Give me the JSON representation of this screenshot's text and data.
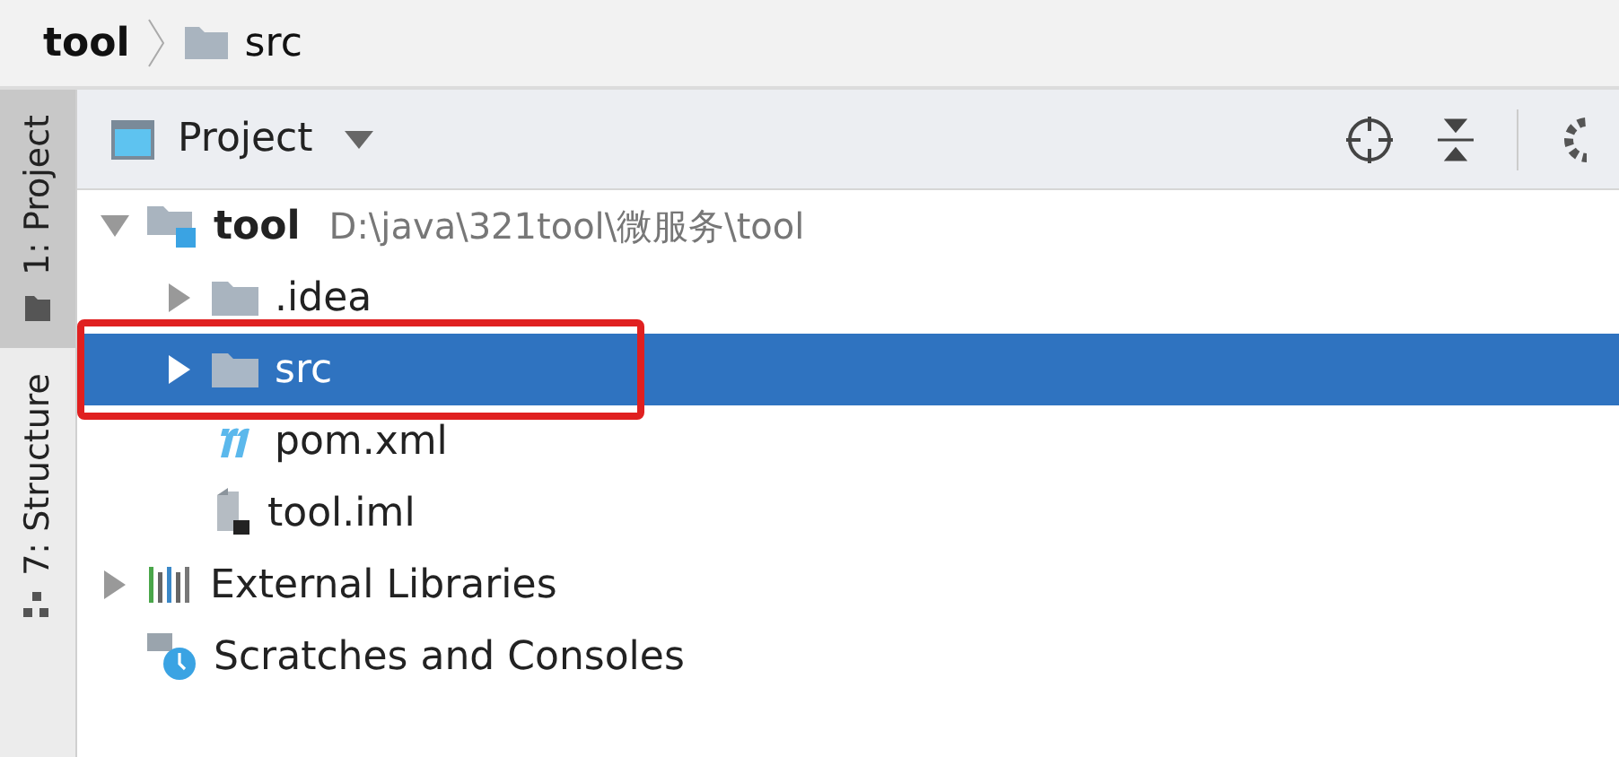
{
  "breadcrumb": [
    {
      "label": "tool",
      "kind": "module"
    },
    {
      "label": "src",
      "kind": "folder"
    }
  ],
  "tool_strip": [
    {
      "label": "1: Project",
      "kind": "folder",
      "selected": true
    },
    {
      "label": "7: Structure",
      "kind": "structure",
      "selected": false
    }
  ],
  "panel": {
    "title": "Project"
  },
  "tree": [
    {
      "label": "tool",
      "path": "D:\\java\\321tool\\微服务\\tool",
      "kind": "module",
      "expanded": true,
      "selected": false,
      "children": [
        {
          "label": ".idea",
          "kind": "folder",
          "expanded": false,
          "selected": false
        },
        {
          "label": "src",
          "kind": "folder",
          "expanded": false,
          "selected": true,
          "highlighted": true
        },
        {
          "label": "pom.xml",
          "kind": "maven",
          "selected": false
        },
        {
          "label": "tool.iml",
          "kind": "iml",
          "selected": false
        }
      ]
    },
    {
      "label": "External Libraries",
      "kind": "libraries",
      "expanded": false,
      "selected": false
    },
    {
      "label": "Scratches and Consoles",
      "kind": "scratches",
      "selected": false
    }
  ]
}
